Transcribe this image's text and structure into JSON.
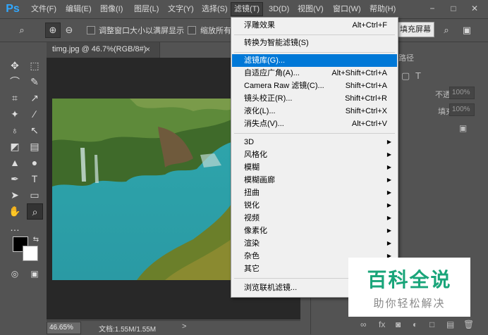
{
  "app": {
    "logo": "Ps"
  },
  "menubar": {
    "items": [
      "文件(F)",
      "编辑(E)",
      "图像(I)",
      "图层(L)",
      "文字(Y)",
      "选择(S)",
      "滤镜(T)",
      "3D(D)",
      "视图(V)",
      "窗口(W)",
      "帮助(H)"
    ],
    "active": "滤镜(T)",
    "window_controls": [
      "−",
      "□",
      "✕"
    ]
  },
  "options": {
    "resize_window": "调整窗口大小以满屏显示",
    "zoom_all": "缩放所有",
    "fill_screen": "填充屏幕"
  },
  "document": {
    "tab_title": "timg.jpg @ 46.7%(RGB/8#)",
    "close": "×",
    "zoom": "46.65%",
    "doc_size": "文档:1.55M/1.55M",
    "status_arrow": ">"
  },
  "panels": {
    "paths_tab": "路径",
    "opacity_label": "不透明度:",
    "opacity_value": "100%",
    "fill_label": "填充:",
    "fill_value": "100%"
  },
  "filter_menu": {
    "top": [
      {
        "label": "浮雕效果",
        "shortcut": "Alt+Ctrl+F"
      }
    ],
    "smart": [
      {
        "label": "转换为智能滤镜(S)",
        "shortcut": ""
      }
    ],
    "main": [
      {
        "label": "滤镜库(G)...",
        "shortcut": ""
      },
      {
        "label": "自适应广角(A)...",
        "shortcut": "Alt+Shift+Ctrl+A"
      },
      {
        "label": "Camera Raw 滤镜(C)...",
        "shortcut": "Shift+Ctrl+A"
      },
      {
        "label": "镜头校正(R)...",
        "shortcut": "Shift+Ctrl+R"
      },
      {
        "label": "液化(L)...",
        "shortcut": "Shift+Ctrl+X"
      },
      {
        "label": "消失点(V)...",
        "shortcut": "Alt+Ctrl+V"
      }
    ],
    "submenus": [
      "3D",
      "风格化",
      "模糊",
      "模糊画廊",
      "扭曲",
      "锐化",
      "视频",
      "像素化",
      "渲染",
      "杂色",
      "其它"
    ],
    "browse": [
      {
        "label": "浏览联机滤镜...",
        "shortcut": ""
      }
    ],
    "highlighted": "滤镜库(G)..."
  },
  "watermark": {
    "title": "百科全说",
    "subtitle": "助你轻松解决"
  },
  "colors": {
    "ui_bg": "#535353",
    "menu_bg": "#f0f0f0",
    "highlight": "#0078d7",
    "watermark_green": "#1aa57a"
  }
}
